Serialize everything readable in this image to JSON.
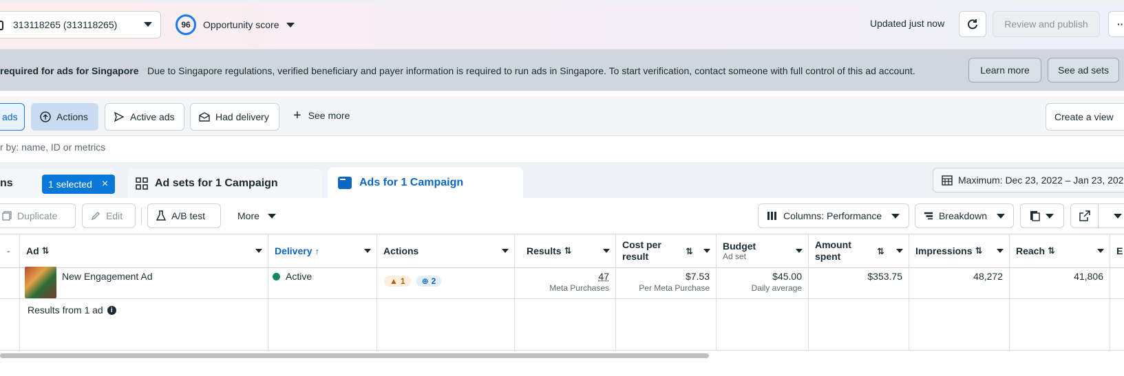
{
  "header": {
    "account_selector": "313118265 (313118265)",
    "opportunity_score": "96",
    "opportunity_label": "Opportunity score",
    "updated_status": "Updated just now",
    "review_publish": "Review and publish",
    "more_label": "···"
  },
  "banner": {
    "title": "required for ads for Singapore",
    "message": "Due to Singapore regulations, verified beneficiary and payer information is required to run ads in Singapore. To start verification, contact someone with full control of this ad account.",
    "learn_more": "Learn more",
    "see_ad_sets": "See ad sets"
  },
  "filters": {
    "chips": [
      "ads",
      "Actions",
      "Active ads",
      "Had delivery"
    ],
    "see_more": "See more",
    "create_view": "Create a view",
    "search_placeholder": "r by: name, ID or metrics"
  },
  "tabs": {
    "campaigns_partial": "ns",
    "selected_badge": "1 selected",
    "ad_sets": "Ad sets for 1 Campaign",
    "ads": "Ads for 1 Campaign",
    "date_range": "Maximum: Dec 23, 2022 – Jan 23, 202"
  },
  "toolbar": {
    "duplicate": "Duplicate",
    "edit": "Edit",
    "ab_test": "A/B test",
    "more": "More",
    "columns": "Columns: Performance",
    "breakdown": "Breakdown"
  },
  "table": {
    "headers": {
      "ad": "Ad",
      "delivery": "Delivery",
      "actions": "Actions",
      "results": "Results",
      "cost_per_result": "Cost per result",
      "budget": "Budget",
      "budget_sub": "Ad set",
      "amount_spent": "Amount spent",
      "impressions": "Impressions",
      "reach": "Reach",
      "extra": "E"
    },
    "row": {
      "ad_name": "New Engagement Ad",
      "delivery": "Active",
      "warn_count": "1",
      "info_count": "2",
      "results": "47",
      "results_sub": "Meta Purchases",
      "cost": "$7.53",
      "cost_sub": "Per Meta Purchase",
      "budget": "$45.00",
      "budget_sub": "Daily average",
      "amount_spent": "$353.75",
      "impressions": "48,272",
      "reach": "41,806"
    },
    "summary": "Results from 1 ad"
  },
  "colors": {
    "accent": "#0a66c2",
    "active": "#16866b",
    "warning": "#b35c00"
  }
}
